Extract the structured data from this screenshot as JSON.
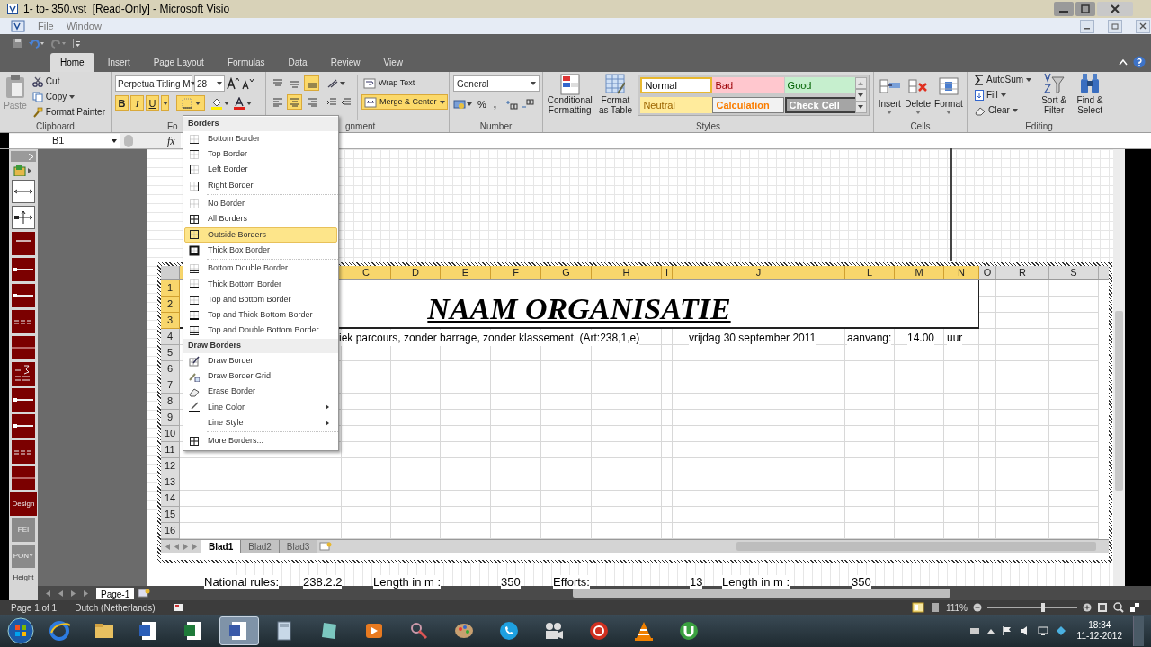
{
  "window": {
    "title": "1- to- 350.vst  [Read-Only] - Microsoft Visio"
  },
  "menu_bar": [
    "File",
    "Window"
  ],
  "ribbon_tabs": [
    {
      "label": "Home",
      "selected": true
    },
    {
      "label": "Insert",
      "selected": false
    },
    {
      "label": "Page Layout",
      "selected": false
    },
    {
      "label": "Formulas",
      "selected": false
    },
    {
      "label": "Data",
      "selected": false
    },
    {
      "label": "Review",
      "selected": false
    },
    {
      "label": "View",
      "selected": false
    }
  ],
  "ribbon": {
    "clipboard": {
      "paste": "Paste",
      "cut": "Cut",
      "copy": "Copy",
      "format_painter": "Format Painter",
      "label": "Clipboard"
    },
    "font": {
      "name": "Perpetua Titling M",
      "size": "28",
      "bold": "B",
      "italic": "I",
      "underline": "U",
      "label": "Fo"
    },
    "alignment": {
      "wrap_text": "Wrap Text",
      "merge_center": "Merge & Center",
      "label": "gnment"
    },
    "number": {
      "format": "General",
      "percent": "%",
      "comma": ",",
      "label": "Number"
    },
    "styles": {
      "conditional": "Conditional Formatting",
      "format_table": "Format as Table",
      "label": "Styles",
      "cells": [
        {
          "label": "Normal",
          "kind": "normal"
        },
        {
          "label": "Bad",
          "kind": "bad"
        },
        {
          "label": "Good",
          "kind": "good"
        },
        {
          "label": "Neutral",
          "kind": "neutral"
        },
        {
          "label": "Calculation",
          "kind": "calculation"
        },
        {
          "label": "Check Cell",
          "kind": "check"
        }
      ]
    },
    "cells": {
      "buttons": [
        "Insert",
        "Delete",
        "Format"
      ],
      "label": "Cells"
    },
    "editing": {
      "autosum": "AutoSum",
      "fill": "Fill",
      "clear": "Clear",
      "sort": "Sort & Filter",
      "find": "Find & Select",
      "label": "Editing"
    }
  },
  "formula_bar": {
    "name_box": "B1",
    "fx": "fx"
  },
  "stencil": [
    {
      "kind": "arrow"
    },
    {
      "kind": "dimension"
    },
    {
      "kind": "line"
    },
    {
      "kind": "rail"
    },
    {
      "kind": "rail"
    },
    {
      "kind": "dashes"
    },
    {
      "kind": "split"
    },
    {
      "kind": "number"
    },
    {
      "kind": "rail"
    },
    {
      "kind": "rail"
    },
    {
      "kind": "dashes"
    },
    {
      "kind": "split"
    },
    {
      "kind": "text",
      "label": "Design"
    },
    {
      "kind": "gray_text",
      "label": "FEI"
    },
    {
      "kind": "gray_text",
      "label": "PONY"
    },
    {
      "kind": "caption",
      "label": "Height"
    }
  ],
  "sheet": {
    "columns": [
      {
        "label": "C",
        "selected": true
      },
      {
        "label": "D",
        "selected": true
      },
      {
        "label": "E",
        "selected": true
      },
      {
        "label": "F",
        "selected": true
      },
      {
        "label": "G",
        "selected": true
      },
      {
        "label": "H",
        "selected": true
      },
      {
        "label": "I",
        "selected": true
      },
      {
        "label": "J",
        "selected": true
      },
      {
        "label": "L",
        "selected": true
      },
      {
        "label": "M",
        "selected": true
      },
      {
        "label": "N",
        "selected": true
      },
      {
        "label": "O",
        "selected": false
      },
      {
        "label": "R",
        "selected": false
      },
      {
        "label": "S",
        "selected": false
      }
    ],
    "rows": [
      {
        "label": "1",
        "selected": true
      },
      {
        "label": "2",
        "selected": true
      },
      {
        "label": "3",
        "selected": true
      },
      {
        "label": "4",
        "selected": false
      },
      {
        "label": "5",
        "selected": false
      },
      {
        "label": "6",
        "selected": false
      },
      {
        "label": "7",
        "selected": false
      },
      {
        "label": "8",
        "selected": false
      },
      {
        "label": "9",
        "selected": false
      },
      {
        "label": "10",
        "selected": false
      },
      {
        "label": "11",
        "selected": false
      },
      {
        "label": "12",
        "selected": false
      },
      {
        "label": "13",
        "selected": false
      },
      {
        "label": "14",
        "selected": false
      },
      {
        "label": "15",
        "selected": false
      },
      {
        "label": "16",
        "selected": false
      }
    ],
    "title": "NAAM ORGANISATIE",
    "row_4": [
      "iek parcours, zonder barrage, zonder klassement. (Art:238,1,e)",
      "vrijdag 30 september 2011",
      "aanvang:",
      "14.00",
      "uur"
    ],
    "tabs": [
      {
        "label": "Blad1",
        "selected": true
      },
      {
        "label": "Blad2",
        "selected": false
      },
      {
        "label": "Blad3",
        "selected": false
      }
    ]
  },
  "borders_menu": [
    {
      "header": "Borders",
      "items": [
        {
          "label": "Bottom Border",
          "kind": "bottom",
          "selected": false
        },
        {
          "label": "Top Border",
          "kind": "top",
          "selected": false
        },
        {
          "label": "Left Border",
          "kind": "left",
          "selected": false
        },
        {
          "label": "Right Border",
          "kind": "right",
          "selected": false
        },
        {
          "kind": "separator"
        },
        {
          "label": "No Border",
          "kind": "none",
          "selected": false
        },
        {
          "label": "All Borders",
          "kind": "all",
          "selected": false
        },
        {
          "label": "Outside Borders",
          "kind": "outside",
          "selected": true
        },
        {
          "label": "Thick Box Border",
          "kind": "thick_box",
          "selected": false
        },
        {
          "kind": "separator"
        },
        {
          "label": "Bottom Double Border",
          "kind": "bottom_double",
          "selected": false
        },
        {
          "label": "Thick Bottom Border",
          "kind": "thick_bottom",
          "selected": false
        },
        {
          "label": "Top and Bottom Border",
          "kind": "top_bottom",
          "selected": false
        },
        {
          "label": "Top and Thick Bottom Border",
          "kind": "top_thick_bottom",
          "selected": false
        },
        {
          "label": "Top and Double Bottom Border",
          "kind": "top_double_bottom",
          "selected": false
        }
      ]
    },
    {
      "header": "Draw Borders",
      "items": [
        {
          "label": "Draw Border",
          "kind": "draw",
          "selected": false
        },
        {
          "label": "Draw Border Grid",
          "kind": "draw_grid",
          "selected": false
        },
        {
          "label": "Erase Border",
          "kind": "erase",
          "selected": false
        },
        {
          "label": "Line Color",
          "kind": "line_color",
          "selected": false,
          "submenu": true
        },
        {
          "label": "Line Style",
          "kind": "line_style",
          "selected": false,
          "submenu": true
        },
        {
          "kind": "separator"
        },
        {
          "label": "More Borders...",
          "kind": "more",
          "selected": false
        }
      ]
    }
  ],
  "page_text": [
    "National rules:",
    "238.2.2",
    "Length in m :",
    "350",
    "Efforts:",
    "13",
    "Length in m :",
    "350"
  ],
  "page_tab": "Page-1",
  "status_bar": {
    "page": "Page 1 of 1",
    "language": "Dutch (Netherlands)",
    "zoom": "111%",
    "zoom_slider": {
      "level": 0.62
    }
  },
  "taskbar": {
    "apps": [
      {
        "kind": "browser",
        "selected": false
      },
      {
        "kind": "folder",
        "selected": false
      },
      {
        "kind": "document",
        "selected": false
      },
      {
        "kind": "spreadsheet",
        "selected": false
      },
      {
        "kind": "diagram",
        "selected": true
      },
      {
        "kind": "calculator",
        "selected": false
      },
      {
        "kind": "note",
        "selected": false
      },
      {
        "kind": "media",
        "selected": false
      },
      {
        "kind": "paint",
        "selected": false
      },
      {
        "kind": "palette",
        "selected": false
      },
      {
        "kind": "phone",
        "selected": false
      },
      {
        "kind": "camera",
        "selected": false
      },
      {
        "kind": "ball",
        "selected": false
      },
      {
        "kind": "cone",
        "selected": false
      },
      {
        "kind": "torrent",
        "selected": false
      }
    ],
    "time": "18:34",
    "date": "11-12-2012"
  }
}
